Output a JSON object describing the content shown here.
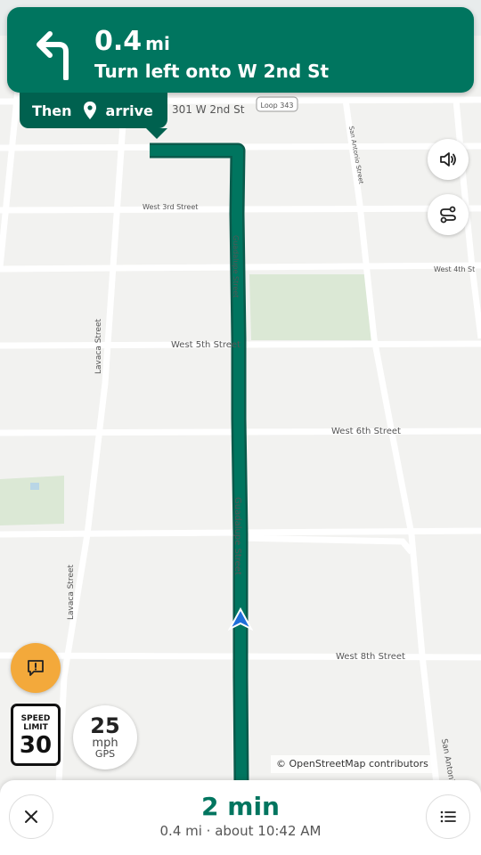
{
  "instruction": {
    "distance_value": "0.4",
    "distance_unit": "mi",
    "text": "Turn left onto W 2nd St",
    "maneuver_icon": "turn-left-icon"
  },
  "then": {
    "label": "Then",
    "icon": "pin-icon",
    "action": "arrive"
  },
  "map": {
    "address_label": "301 W 2nd St",
    "route_shield": "Loop 343",
    "streets": {
      "west_3rd": "West 3rd Street",
      "west_4th": "West 4th St",
      "west_5th": "West 5th Street",
      "west_6th": "West 6th Street",
      "west_8th": "West 8th Street",
      "guadalupe_north": "Guadalupe Street",
      "guadalupe_south": "Guadalupe Street",
      "lavaca_north": "Lavaca Street",
      "lavaca_south": "Lavaca Street",
      "san_antonio_north": "San Antonio Street",
      "san_antonio_south": "San Antonio Street"
    },
    "route_color": "#00755f",
    "attribution": "© OpenStreetMap contributors"
  },
  "controls": {
    "mute_icon": "speaker-icon",
    "route_overview_icon": "route-icon",
    "report_icon": "report-icon"
  },
  "speed_limit": {
    "title_line1": "SPEED",
    "title_line2": "LIMIT",
    "value": "30"
  },
  "current_speed": {
    "value": "25",
    "unit": "mph",
    "source": "GPS"
  },
  "trip": {
    "duration": "2 min",
    "summary": "0.4 mi · about 10:42 AM"
  },
  "colors": {
    "primary": "#00755f",
    "accent": "#f3a93b",
    "position_marker": "#1e6fd9"
  }
}
